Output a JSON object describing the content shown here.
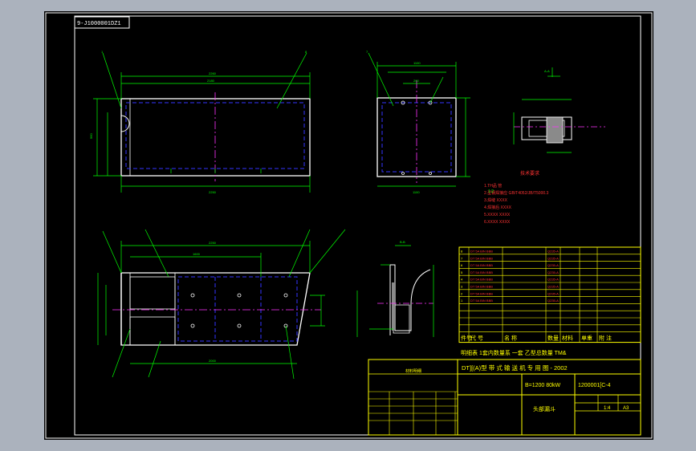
{
  "colors": {
    "background": "#abb2bd",
    "sheet": "#000000",
    "outline": "#ffffff",
    "dimension": "#00ff00",
    "hidden": "#2222ff",
    "center": "#ff00ff",
    "table": "#ffff00",
    "table_text": "#ff3333",
    "fill": "#8a8a8a"
  },
  "drawing_code_box": "9-J1000001DZ1",
  "scale_label": "1:2",
  "tech_requirements": {
    "title": "技术要求",
    "lines": [
      "1.TH品 管",
      "2.型钢焊接应 GB/T4052/JB/T5000.3",
      "3.焊缝 XXXX",
      "4.焊接后 XXXX",
      "5.XXXX XXXX",
      "6.XXXX XXXX"
    ]
  },
  "bom": {
    "rows": [
      [
        "8",
        "DT 5A BIN BBB",
        "",
        "Q235-A",
        "",
        "",
        ""
      ],
      [
        "7",
        "DT 5A BIN BBB",
        "",
        "Q235-A",
        "",
        "",
        ""
      ],
      [
        "6",
        "DT 5A BIN BBB",
        "",
        "Q235-A",
        "",
        "",
        ""
      ],
      [
        "5",
        "DT 5A BIN BBB",
        "",
        "Q235-A",
        "",
        "",
        ""
      ],
      [
        "4",
        "DT 5A BIN BBB",
        "",
        "Q235-A",
        "",
        "",
        ""
      ],
      [
        "3",
        "DT 5A BIN BBB",
        "",
        "Q235-A",
        "",
        "",
        ""
      ],
      [
        "2",
        "DT 5A BIN BBB",
        "",
        "Q235-A",
        "",
        "",
        ""
      ],
      [
        "1",
        "DT 5A BIN BBB",
        "",
        "Q235-A",
        "",
        "",
        ""
      ],
      [
        "",
        "",
        "",
        "",
        "",
        "",
        ""
      ],
      [
        "",
        "",
        "",
        "",
        "",
        "",
        ""
      ],
      [
        "",
        "",
        "",
        "",
        "",
        "",
        ""
      ],
      [
        "",
        "",
        "",
        "",
        "",
        "",
        ""
      ]
    ],
    "header": [
      "件号",
      "代 号",
      "名 称",
      "数量",
      "材料",
      "单重",
      "附 注"
    ],
    "note_line": "明细表  1套内数量系 一套  乙型总数量  TM&"
  },
  "title_block": {
    "series_title": "DT][(A)型  带 式 输 送 机 专 用 图 - 2002",
    "spec": "B=1200 80kW",
    "drawing_no": "1200001[C-4",
    "part_name": "头部漏斗",
    "scale_cell": "1:4",
    "sheet_cell": "A3"
  },
  "revision_table": {
    "title": "材料明细",
    "note_lines": [
      "",
      ""
    ],
    "rows": [
      [
        "",
        "",
        "",
        "",
        "",
        ""
      ],
      [
        "",
        "",
        "",
        "",
        "",
        ""
      ],
      [
        "",
        "",
        "",
        "",
        "",
        ""
      ],
      [
        "",
        "",
        "",
        "",
        "",
        ""
      ],
      [
        "",
        "",
        "",
        "",
        "",
        ""
      ]
    ]
  }
}
